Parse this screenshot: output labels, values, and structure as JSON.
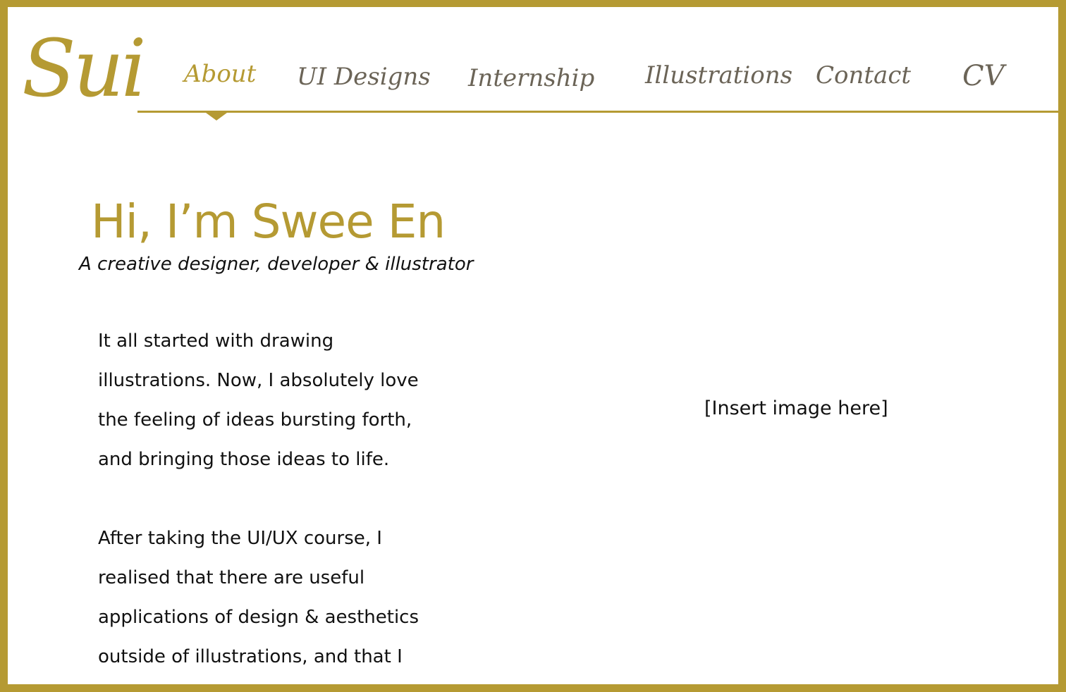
{
  "brand": {
    "logo_text": "Sui",
    "accent_color": "#b59a33"
  },
  "nav": {
    "items": [
      {
        "label": "About",
        "active": true
      },
      {
        "label": "UI Designs",
        "active": false
      },
      {
        "label": "Internship",
        "active": false
      },
      {
        "label": "Illustrations",
        "active": false
      },
      {
        "label": "Contact",
        "active": false
      },
      {
        "label": "CV",
        "active": false
      }
    ]
  },
  "hero": {
    "title": "Hi, I’m Swee En",
    "subtitle": "A creative designer, developer & illustrator"
  },
  "intro": {
    "paragraph_1": [
      "It all started with drawing",
      "illustrations. Now, I absolutely love",
      "the feeling of ideas bursting forth,",
      "and bringing those ideas to life."
    ],
    "paragraph_2": [
      "After taking the UI/UX course, I",
      "realised that there are useful",
      "applications of design & aesthetics",
      "outside of illustrations, and that I"
    ]
  },
  "image_placeholder": {
    "text": "[Insert image here]"
  }
}
